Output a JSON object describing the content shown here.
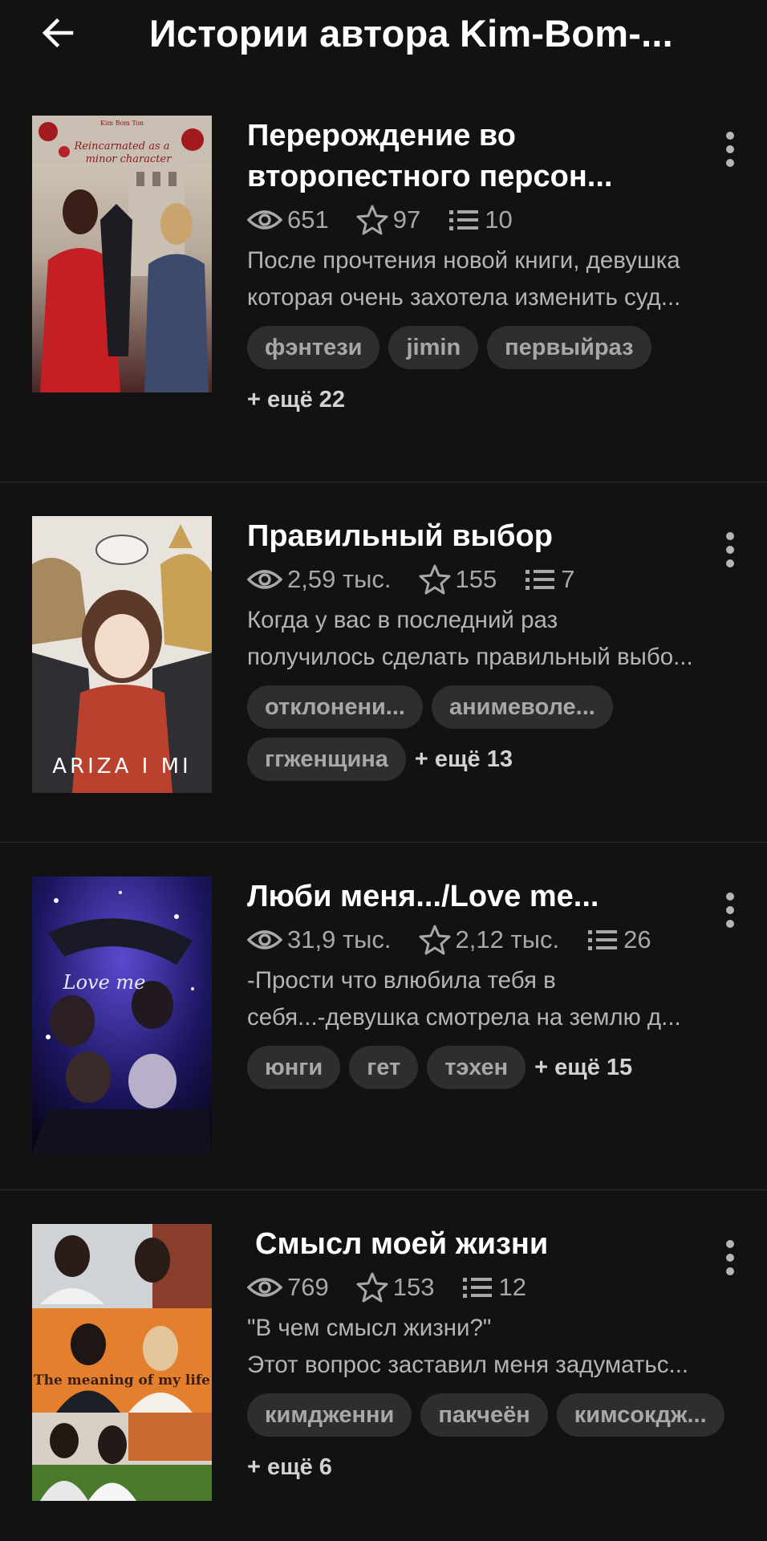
{
  "header": {
    "title": "Истории автора Kim-Bom-..."
  },
  "stories": [
    {
      "title": "Перерождение во второпестного персон...",
      "views": "651",
      "votes": "97",
      "parts": "10",
      "description_lines": [
        "После прочтения новой книги, девушка",
        "которая очень захотела изменить суд..."
      ],
      "tags": [
        "фэнтези",
        "jimin",
        "первыйраз"
      ],
      "more_tags": "+ ещё 22",
      "cover": {
        "title_text": "Reincarnated as a minor character",
        "author_text": "Kim Bom Ton",
        "colors": [
          "#5a1a1a",
          "#c41f24",
          "#d9d2c6"
        ]
      }
    },
    {
      "title": "Правильный выбор",
      "views": "2,59 тыс.",
      "votes": "155",
      "parts": "7",
      "description_lines": [
        "Когда у вас в последний раз",
        "получилось сделать правильный выбо..."
      ],
      "tags": [
        "отклонени...",
        "анимеволе...",
        "ггженщина"
      ],
      "more_tags": "+ ещё 13",
      "cover": {
        "title_text": "ARIZA I MI",
        "colors": [
          "#e6e1da",
          "#8b5a3c",
          "#3a2b2b"
        ]
      }
    },
    {
      "title": "Люби меня.../Love me...",
      "views": "31,9 тыс.",
      "votes": "2,12 тыс.",
      "parts": "26",
      "description_lines": [
        "-Прости что влюбила тебя в",
        "себя...-девушка смотрела на землю д..."
      ],
      "tags": [
        "юнги",
        "гет",
        "тэхен"
      ],
      "more_tags": "+ ещё 15",
      "cover": {
        "title_text": "Love me",
        "colors": [
          "#0d0b3a",
          "#4b3bb0",
          "#0a0a14"
        ]
      }
    },
    {
      "title": "Смысл моей жизни",
      "views": "769",
      "votes": "153",
      "parts": "12",
      "description_lines": [
        "\"В чем смысл жизни?\"",
        "Этот вопрос заставил меня задуматьс..."
      ],
      "tags": [
        "кимдженни",
        "пакчеён",
        "кимсокдж..."
      ],
      "more_tags": "+ ещё 6",
      "cover": {
        "title_text": "The meaning of my life",
        "colors": [
          "#e68a30",
          "#cfd4d9",
          "#2c3b22"
        ]
      }
    }
  ]
}
